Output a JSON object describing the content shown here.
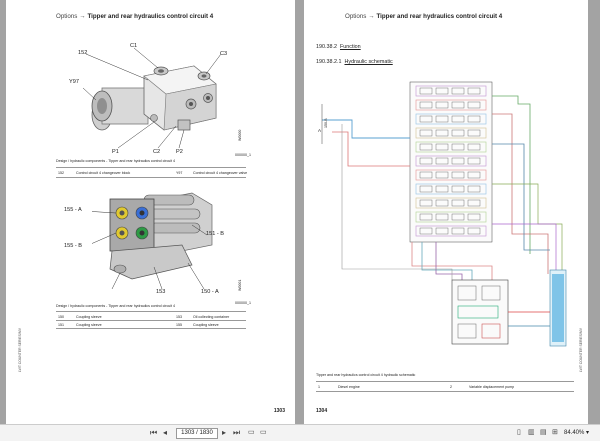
{
  "app": {
    "left_page": {
      "header_prefix": "Options",
      "header_arrow": "→",
      "header_title": "Tipper and rear hydraulics control circuit 4",
      "figure1": {
        "labels": [
          "152",
          "C1",
          "C3",
          "Y97",
          "P1",
          "C2",
          "P2"
        ],
        "code": "000000_1",
        "side_code": "W0000",
        "caption": "Design / hydraulic components - Tipper and rear hydraulics control circuit 4",
        "legend": [
          {
            "num": "152",
            "text": "Control circuit 4 changeover block"
          },
          {
            "num": "Y97",
            "text": "Control circuit 4 changeover valve"
          }
        ]
      },
      "figure2": {
        "labels": [
          "155 - A",
          "155 - B",
          "151 - B",
          "153",
          "150 - A"
        ],
        "code": "000000_1",
        "side_code": "W0001",
        "caption": "Design / hydraulic components - Tipper and rear hydraulics control circuit 4",
        "legend": [
          {
            "num": "150",
            "text": "Coupling sleeve"
          },
          {
            "num": "153",
            "text": "Oil collecting container"
          },
          {
            "num": "151",
            "text": "Coupling sleeve"
          },
          {
            "num": "155",
            "text": "Coupling sleeve"
          }
        ]
      },
      "side_label": "LWT COUNTER SERIES/MV",
      "page_number": "1303"
    },
    "right_page": {
      "header_prefix": "Options",
      "header_arrow": "→",
      "header_title": "Tipper and rear hydraulics control circuit 4",
      "section1_num": "190.38.2",
      "section1_title": "Function",
      "section2_num": "190.38.2.1",
      "section2_title": "Hydraulic schematic",
      "schematic_label_a": "A",
      "schematic_label_b": "150-B",
      "caption": "Tipper and rear hydraulics control circuit 4 hydraulic schematic",
      "legend": [
        {
          "num": "1",
          "text": "Diesel engine"
        },
        {
          "num": "2",
          "text": "Variable displacement pump"
        }
      ],
      "side_label": "LWT COUNTER SERIES/MV",
      "page_number": "1304"
    },
    "toolbar": {
      "page_input": "1303 / 1830",
      "zoom": "84.40%",
      "zoom_arrow": "▾",
      "icons": [
        "first-page-icon",
        "prev-page-icon",
        "next-page-icon",
        "last-page-icon"
      ]
    }
  }
}
